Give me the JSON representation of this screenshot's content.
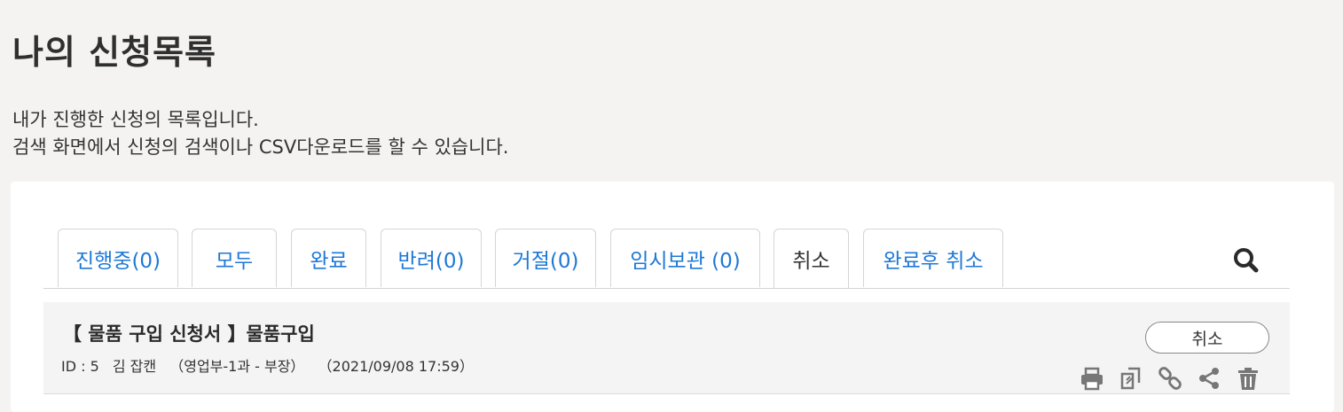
{
  "page": {
    "title": "나의 신청목록",
    "description_line1": "내가 진행한 신청의 목록입니다.",
    "description_line2": "검색 화면에서 신청의 검색이나 CSV다운로드를 할 수 있습니다."
  },
  "tabs": [
    {
      "label": "진행중(0)",
      "active": false
    },
    {
      "label": "모두",
      "active": false
    },
    {
      "label": "완료",
      "active": false
    },
    {
      "label": "반려(0)",
      "active": false
    },
    {
      "label": "거절(0)",
      "active": false
    },
    {
      "label": "임시보관 (0)",
      "active": false
    },
    {
      "label": "취소",
      "active": true
    },
    {
      "label": "완료후 취소",
      "active": false
    }
  ],
  "search": {
    "icon": "search-icon"
  },
  "items": [
    {
      "title": "【 물품 구입 신청서 】물품구입",
      "id": "ID : 5",
      "applicant": "김 잡캔",
      "department": "（영업부-1과 - 부장）",
      "date": "（2021/09/08 17:59）",
      "button_label": "취소",
      "actions": [
        "print-icon",
        "copy-icon",
        "link-icon",
        "share-icon",
        "trash-icon"
      ]
    }
  ],
  "colors": {
    "accent": "#1e78d6",
    "background": "#f4f3f2",
    "card": "#ffffff"
  }
}
